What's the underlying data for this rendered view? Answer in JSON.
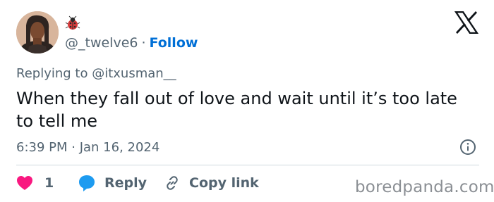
{
  "author": {
    "handle": "@_twelve6",
    "separator": "·",
    "follow_label": "Follow",
    "name_emoji": "ladybug-emoji"
  },
  "tweet": {
    "replying_to": "Replying to @itxusman__",
    "text": "When they fall out of love and wait until it’s too late to tell me",
    "timestamp": "6:39 PM · Jan 16, 2024"
  },
  "actions": {
    "like_count": "1",
    "reply_label": "Reply",
    "copy_link_label": "Copy link"
  },
  "icons": {
    "logo": "x-logo-icon",
    "info": "info-icon",
    "like": "heart-icon",
    "reply": "speech-bubble-icon",
    "copy": "link-icon"
  },
  "watermark": "boredpanda.com",
  "colors": {
    "accent": "#006fd6",
    "like": "#f91880",
    "reply": "#1d9bf0",
    "muted": "#536471"
  }
}
